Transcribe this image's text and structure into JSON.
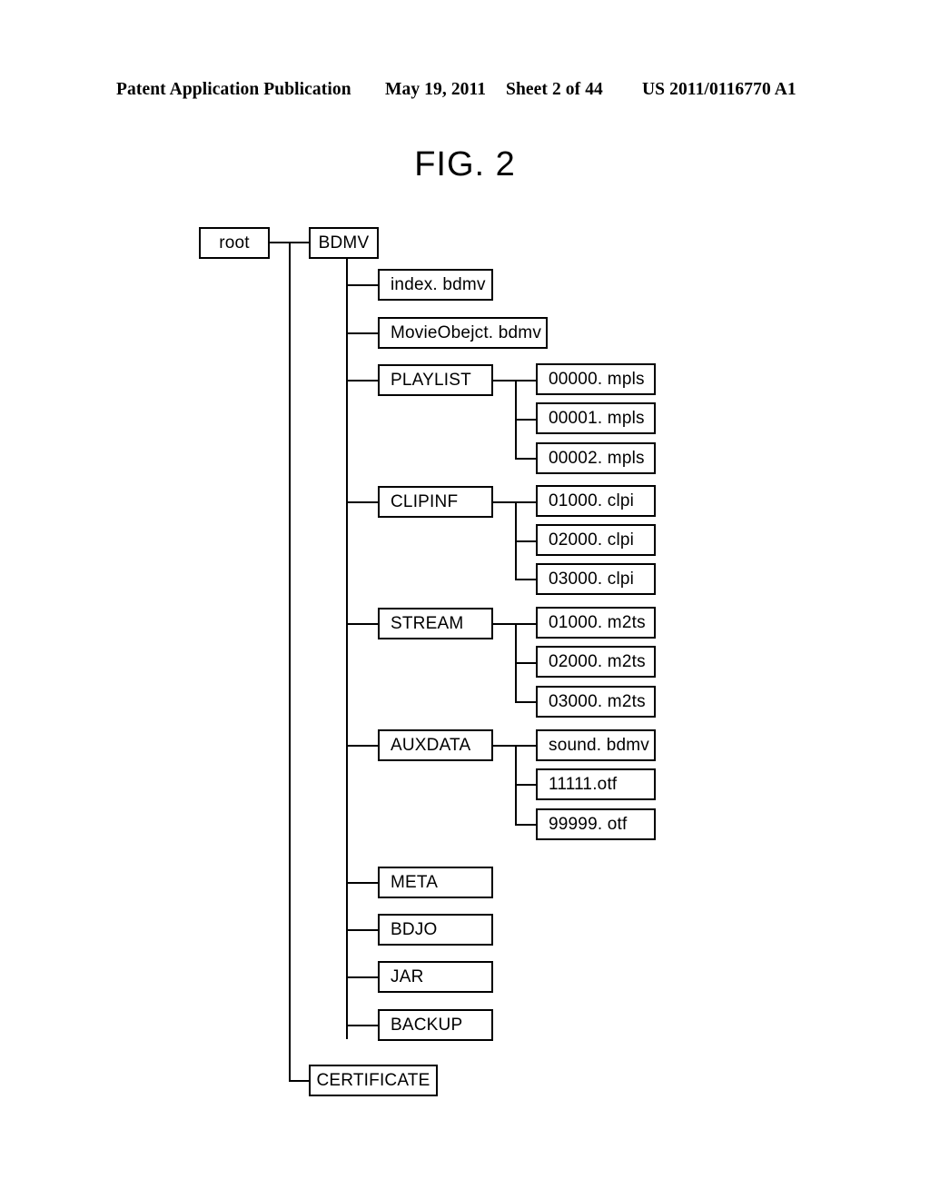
{
  "header": {
    "publication": "Patent Application Publication",
    "date": "May 19, 2011",
    "sheet": "Sheet 2 of 44",
    "number": "US 2011/0116770 A1"
  },
  "figure": {
    "title": "FIG. 2",
    "type": "directory-tree",
    "root": {
      "label": "root"
    },
    "nodes": {
      "bdmv": "BDMV",
      "certificate": "CERTIFICATE",
      "index_bdmv": "index. bdmv",
      "movieobject_bdmv": "MovieObejct. bdmv",
      "playlist": "PLAYLIST",
      "clipinf": "CLIPINF",
      "stream": "STREAM",
      "auxdata": "AUXDATA",
      "meta": "META",
      "bdjo": "BDJO",
      "jar": "JAR",
      "backup": "BACKUP",
      "playlist_files": [
        "00000. mpls",
        "00001. mpls",
        "00002. mpls"
      ],
      "clipinf_files": [
        "01000. clpi",
        "02000. clpi",
        "03000. clpi"
      ],
      "stream_files": [
        "01000. m2ts",
        "02000. m2ts",
        "03000. m2ts"
      ],
      "auxdata_files": [
        "sound. bdmv",
        "11111.otf",
        "99999. otf"
      ]
    }
  },
  "colors": {
    "line": "#000000",
    "background": "#ffffff",
    "text": "#000000"
  }
}
